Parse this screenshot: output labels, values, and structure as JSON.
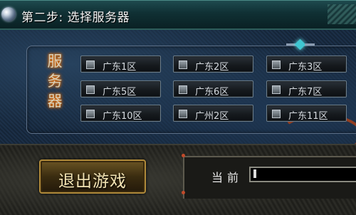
{
  "window": {
    "title": "第二步: 选择服务器"
  },
  "server_panel": {
    "vertical_label": [
      "服",
      "务",
      "器"
    ],
    "servers": [
      {
        "label": "广东1区",
        "checked": false
      },
      {
        "label": "广东2区",
        "checked": false
      },
      {
        "label": "广东3区",
        "checked": false
      },
      {
        "label": "广东5区",
        "checked": false
      },
      {
        "label": "广东6区",
        "checked": false
      },
      {
        "label": "广东7区",
        "checked": false
      },
      {
        "label": "广东10区",
        "checked": false
      },
      {
        "label": "广州2区",
        "checked": false
      },
      {
        "label": "广东11区",
        "checked": false
      }
    ]
  },
  "footer": {
    "exit_label": "退出游戏",
    "current_label": "当前"
  },
  "colors": {
    "title_bar": "#103034",
    "panel_bg": "#1b2f47",
    "button_text": "#d6dbe0",
    "exit_button_gold": "#b08a3a",
    "glow": "#ff6a00"
  },
  "icons": {
    "title_orb": "orb-icon",
    "frame_gem": "gem-ornament-icon",
    "checkbox": "checkbox-icon"
  }
}
